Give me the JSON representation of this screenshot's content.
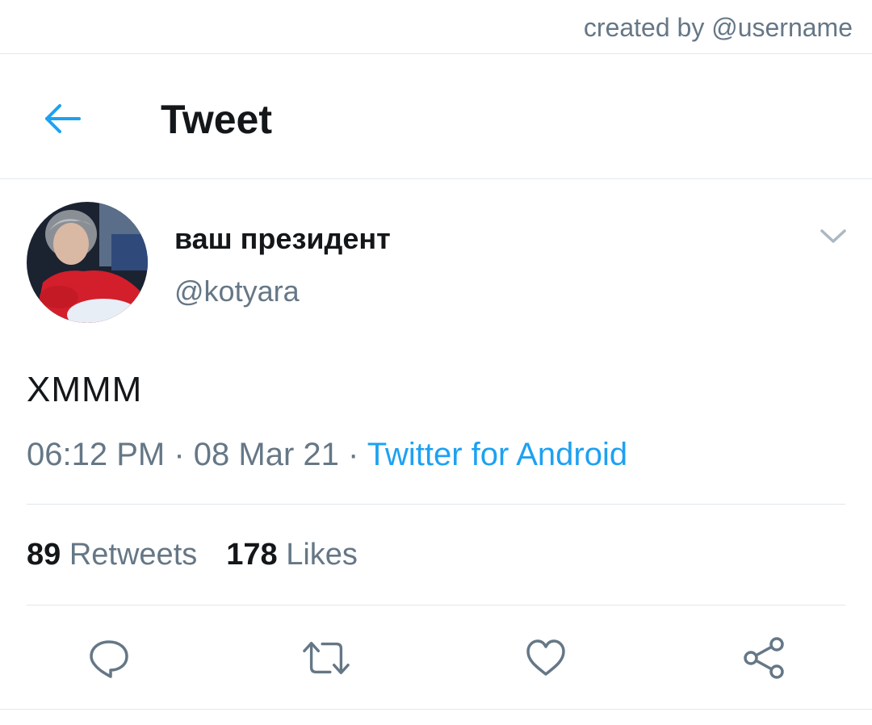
{
  "credit": "created by @username",
  "header": {
    "title": "Tweet"
  },
  "tweet": {
    "display_name": "ваш президент",
    "handle": "@kotyara",
    "text": "ХМММ",
    "time": "06:12 PM",
    "separator": "·",
    "date": "08 Mar 21",
    "source": "Twitter for Android"
  },
  "stats": {
    "retweets_count": "89",
    "retweets_label": "Retweets",
    "likes_count": "178",
    "likes_label": "Likes"
  },
  "icons": {
    "back": "arrow-left-icon",
    "more": "chevron-down-icon",
    "reply": "comment-bubble-icon",
    "retweet": "retweet-icon",
    "like": "heart-icon",
    "share": "share-icon"
  },
  "colors": {
    "accent": "#1da1f2",
    "secondary_text": "#657786",
    "primary_text": "#14171a"
  }
}
